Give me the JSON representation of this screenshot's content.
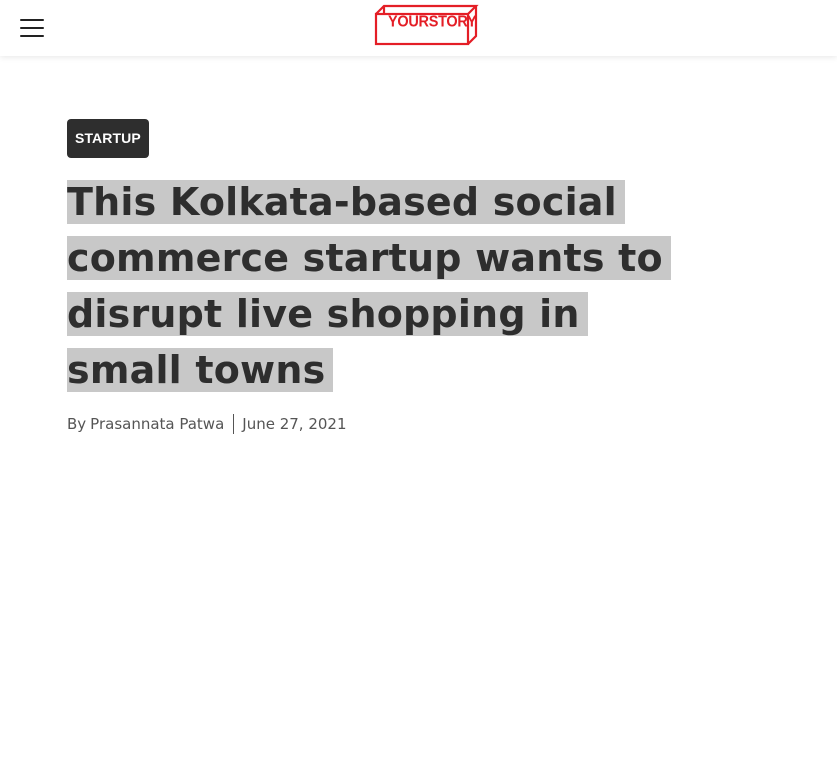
{
  "header": {
    "logo_text": "YOURSTORY",
    "brand_color": "#e41e26",
    "menu_icon": "hamburger-menu-icon"
  },
  "article": {
    "category": "STARTUP",
    "title": "This Kolkata-based social commerce startup wants to disrupt live shopping in small towns",
    "byline": {
      "by": "By",
      "author": "Prasannata Patwa",
      "date": "June 27, 2021"
    }
  },
  "colors": {
    "category_bg": "#2e2e2e",
    "title_highlight": "#c8c8c8",
    "title_text": "#2e2e2e",
    "byline_text": "#555555"
  }
}
